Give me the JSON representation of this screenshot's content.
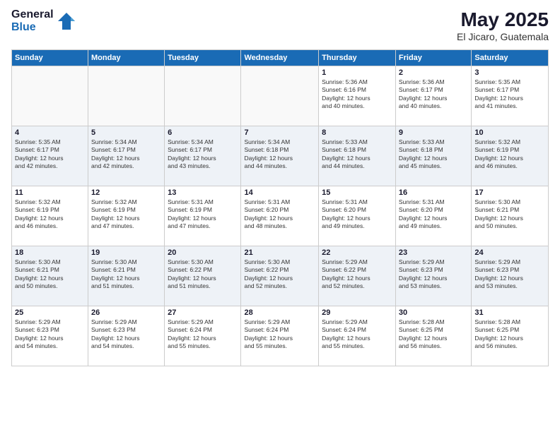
{
  "header": {
    "logo_general": "General",
    "logo_blue": "Blue",
    "month_year": "May 2025",
    "location": "El Jicaro, Guatemala"
  },
  "weekdays": [
    "Sunday",
    "Monday",
    "Tuesday",
    "Wednesday",
    "Thursday",
    "Friday",
    "Saturday"
  ],
  "weeks": [
    [
      {
        "day": "",
        "info": ""
      },
      {
        "day": "",
        "info": ""
      },
      {
        "day": "",
        "info": ""
      },
      {
        "day": "",
        "info": ""
      },
      {
        "day": "1",
        "info": "Sunrise: 5:36 AM\nSunset: 6:16 PM\nDaylight: 12 hours\nand 40 minutes."
      },
      {
        "day": "2",
        "info": "Sunrise: 5:36 AM\nSunset: 6:17 PM\nDaylight: 12 hours\nand 40 minutes."
      },
      {
        "day": "3",
        "info": "Sunrise: 5:35 AM\nSunset: 6:17 PM\nDaylight: 12 hours\nand 41 minutes."
      }
    ],
    [
      {
        "day": "4",
        "info": "Sunrise: 5:35 AM\nSunset: 6:17 PM\nDaylight: 12 hours\nand 42 minutes."
      },
      {
        "day": "5",
        "info": "Sunrise: 5:34 AM\nSunset: 6:17 PM\nDaylight: 12 hours\nand 42 minutes."
      },
      {
        "day": "6",
        "info": "Sunrise: 5:34 AM\nSunset: 6:17 PM\nDaylight: 12 hours\nand 43 minutes."
      },
      {
        "day": "7",
        "info": "Sunrise: 5:34 AM\nSunset: 6:18 PM\nDaylight: 12 hours\nand 44 minutes."
      },
      {
        "day": "8",
        "info": "Sunrise: 5:33 AM\nSunset: 6:18 PM\nDaylight: 12 hours\nand 44 minutes."
      },
      {
        "day": "9",
        "info": "Sunrise: 5:33 AM\nSunset: 6:18 PM\nDaylight: 12 hours\nand 45 minutes."
      },
      {
        "day": "10",
        "info": "Sunrise: 5:32 AM\nSunset: 6:19 PM\nDaylight: 12 hours\nand 46 minutes."
      }
    ],
    [
      {
        "day": "11",
        "info": "Sunrise: 5:32 AM\nSunset: 6:19 PM\nDaylight: 12 hours\nand 46 minutes."
      },
      {
        "day": "12",
        "info": "Sunrise: 5:32 AM\nSunset: 6:19 PM\nDaylight: 12 hours\nand 47 minutes."
      },
      {
        "day": "13",
        "info": "Sunrise: 5:31 AM\nSunset: 6:19 PM\nDaylight: 12 hours\nand 47 minutes."
      },
      {
        "day": "14",
        "info": "Sunrise: 5:31 AM\nSunset: 6:20 PM\nDaylight: 12 hours\nand 48 minutes."
      },
      {
        "day": "15",
        "info": "Sunrise: 5:31 AM\nSunset: 6:20 PM\nDaylight: 12 hours\nand 49 minutes."
      },
      {
        "day": "16",
        "info": "Sunrise: 5:31 AM\nSunset: 6:20 PM\nDaylight: 12 hours\nand 49 minutes."
      },
      {
        "day": "17",
        "info": "Sunrise: 5:30 AM\nSunset: 6:21 PM\nDaylight: 12 hours\nand 50 minutes."
      }
    ],
    [
      {
        "day": "18",
        "info": "Sunrise: 5:30 AM\nSunset: 6:21 PM\nDaylight: 12 hours\nand 50 minutes."
      },
      {
        "day": "19",
        "info": "Sunrise: 5:30 AM\nSunset: 6:21 PM\nDaylight: 12 hours\nand 51 minutes."
      },
      {
        "day": "20",
        "info": "Sunrise: 5:30 AM\nSunset: 6:22 PM\nDaylight: 12 hours\nand 51 minutes."
      },
      {
        "day": "21",
        "info": "Sunrise: 5:30 AM\nSunset: 6:22 PM\nDaylight: 12 hours\nand 52 minutes."
      },
      {
        "day": "22",
        "info": "Sunrise: 5:29 AM\nSunset: 6:22 PM\nDaylight: 12 hours\nand 52 minutes."
      },
      {
        "day": "23",
        "info": "Sunrise: 5:29 AM\nSunset: 6:23 PM\nDaylight: 12 hours\nand 53 minutes."
      },
      {
        "day": "24",
        "info": "Sunrise: 5:29 AM\nSunset: 6:23 PM\nDaylight: 12 hours\nand 53 minutes."
      }
    ],
    [
      {
        "day": "25",
        "info": "Sunrise: 5:29 AM\nSunset: 6:23 PM\nDaylight: 12 hours\nand 54 minutes."
      },
      {
        "day": "26",
        "info": "Sunrise: 5:29 AM\nSunset: 6:23 PM\nDaylight: 12 hours\nand 54 minutes."
      },
      {
        "day": "27",
        "info": "Sunrise: 5:29 AM\nSunset: 6:24 PM\nDaylight: 12 hours\nand 55 minutes."
      },
      {
        "day": "28",
        "info": "Sunrise: 5:29 AM\nSunset: 6:24 PM\nDaylight: 12 hours\nand 55 minutes."
      },
      {
        "day": "29",
        "info": "Sunrise: 5:29 AM\nSunset: 6:24 PM\nDaylight: 12 hours\nand 55 minutes."
      },
      {
        "day": "30",
        "info": "Sunrise: 5:28 AM\nSunset: 6:25 PM\nDaylight: 12 hours\nand 56 minutes."
      },
      {
        "day": "31",
        "info": "Sunrise: 5:28 AM\nSunset: 6:25 PM\nDaylight: 12 hours\nand 56 minutes."
      }
    ]
  ]
}
